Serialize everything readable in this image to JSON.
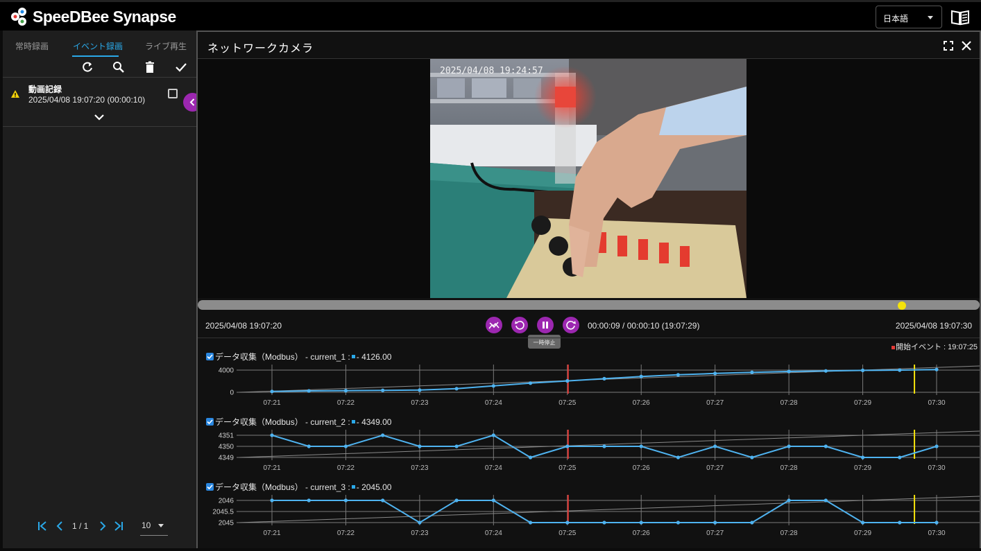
{
  "app": {
    "logo_text": "SpeeDBee Synapse",
    "language": "日本語"
  },
  "tabs": [
    {
      "label": "常時録画",
      "active": false
    },
    {
      "label": "イベント録画",
      "active": true
    },
    {
      "label": "ライブ再生",
      "active": false
    }
  ],
  "event_list": {
    "items": [
      {
        "title": "動画記録",
        "time": "2025/04/08 19:07:20 (00:00:10)"
      }
    ]
  },
  "pager": {
    "page_text": "1 / 1",
    "per_page": "10"
  },
  "camera": {
    "title": "ネットワークカメラ",
    "video_timestamp": "2025/04/08 19:24:57"
  },
  "playback": {
    "start_time": "2025/04/08 19:07:20",
    "end_time": "2025/04/08 19:07:30",
    "progress_text": "00:00:09 / 00:00:10 (19:07:29)",
    "tooltip": "一時停止",
    "position_fraction": 0.9,
    "event_label": "開始イベント : 19:07:25"
  },
  "colors": {
    "accent": "#9c27b0",
    "tab_active": "#2aa9e9",
    "series": "#4fb3f0",
    "event_line": "#e53935",
    "cursor_line": "#f5e30b"
  },
  "chart_data": [
    {
      "type": "line",
      "label": "データ収集（Modbus） - current_1 :",
      "current_value": "- 4126.00",
      "x": [
        "07:21",
        "07:21.5",
        "07:22",
        "07:22.5",
        "07:23",
        "07:23.5",
        "07:24",
        "07:24.5",
        "07:25",
        "07:25.5",
        "07:26",
        "07:26.5",
        "07:27",
        "07:27.5",
        "07:28",
        "07:28.5",
        "07:29",
        "07:29.5",
        "07:30"
      ],
      "values": [
        150,
        250,
        300,
        350,
        400,
        650,
        1150,
        1650,
        2050,
        2450,
        2850,
        3150,
        3400,
        3600,
        3750,
        3850,
        3950,
        4000,
        4100
      ],
      "ticks_x": [
        "07:21",
        "07:22",
        "07:23",
        "07:24",
        "07:25",
        "07:26",
        "07:27",
        "07:28",
        "07:29",
        "07:30"
      ],
      "ticks_y": [
        "4000",
        "0"
      ],
      "ylim": [
        0,
        4000
      ],
      "event_x": "07:25",
      "cursor_x": "07:29.7"
    },
    {
      "type": "line",
      "label": "データ収集（Modbus） - current_2 :",
      "current_value": "- 4349.00",
      "x": [
        "07:21",
        "07:21.5",
        "07:22",
        "07:22.5",
        "07:23",
        "07:23.5",
        "07:24",
        "07:24.5",
        "07:25",
        "07:25.5",
        "07:26",
        "07:26.5",
        "07:27",
        "07:27.5",
        "07:28",
        "07:28.5",
        "07:29",
        "07:29.5",
        "07:30"
      ],
      "values": [
        4351,
        4350,
        4350,
        4351,
        4350,
        4350,
        4351,
        4349,
        4350,
        4350,
        4350,
        4349,
        4350,
        4349,
        4350,
        4350,
        4349,
        4349,
        4350
      ],
      "ticks_x": [
        "07:21",
        "07:22",
        "07:23",
        "07:24",
        "07:25",
        "07:26",
        "07:27",
        "07:28",
        "07:29",
        "07:30"
      ],
      "ticks_y": [
        "4351",
        "4350",
        "4349"
      ],
      "ylim": [
        4349,
        4351
      ],
      "event_x": "07:25",
      "cursor_x": "07:29.7"
    },
    {
      "type": "line",
      "label": "データ収集（Modbus） - current_3 :",
      "current_value": "- 2045.00",
      "x": [
        "07:21",
        "07:21.5",
        "07:22",
        "07:22.5",
        "07:23",
        "07:23.5",
        "07:24",
        "07:24.5",
        "07:25",
        "07:25.5",
        "07:26",
        "07:26.5",
        "07:27",
        "07:27.5",
        "07:28",
        "07:28.5",
        "07:29",
        "07:29.5",
        "07:30"
      ],
      "values": [
        2046,
        2046,
        2046,
        2046,
        2045,
        2046,
        2046,
        2045,
        2045,
        2045,
        2045,
        2045,
        2045,
        2045,
        2046,
        2046,
        2045,
        2045,
        2045
      ],
      "ticks_x": [
        "07:21",
        "07:22",
        "07:23",
        "07:24",
        "07:25",
        "07:26",
        "07:27",
        "07:28",
        "07:29",
        "07:30"
      ],
      "ticks_y": [
        "2046",
        "2045.5",
        "2045"
      ],
      "ylim": [
        2045,
        2046
      ],
      "event_x": "07:25",
      "cursor_x": "07:29.7"
    }
  ]
}
